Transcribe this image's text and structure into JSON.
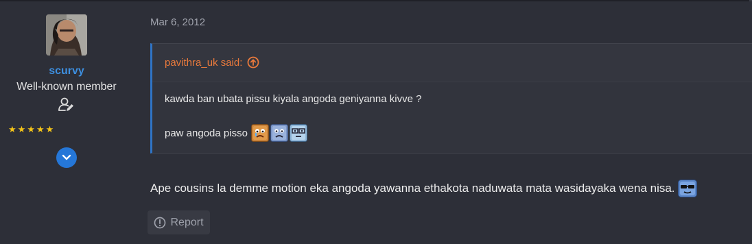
{
  "post": {
    "user": {
      "name": "scurvy",
      "title": "Well-known member",
      "stars": 5,
      "badge_icon": "user-edit-icon",
      "expand_icon": "chevron-down-icon"
    },
    "date": "Mar 6, 2012",
    "quote": {
      "author": "pavithra_uk said:",
      "jump_icon": "arrow-up-circle-icon",
      "line1": "kawda ban ubata pissu kiyala angoda geniyanna kivve ?",
      "line2": "paw angoda pisso",
      "emojis": [
        "crying-face-emoji",
        "sad-face-emoji",
        "nerd-face-emoji"
      ]
    },
    "message": "Ape cousins la demme motion eka angoda yawanna ethakota naduwata mata wasidayaka wena nisa.",
    "message_emoji": "sunglasses-face-emoji",
    "report_label": "Report",
    "report_icon": "alert-circle-icon"
  }
}
